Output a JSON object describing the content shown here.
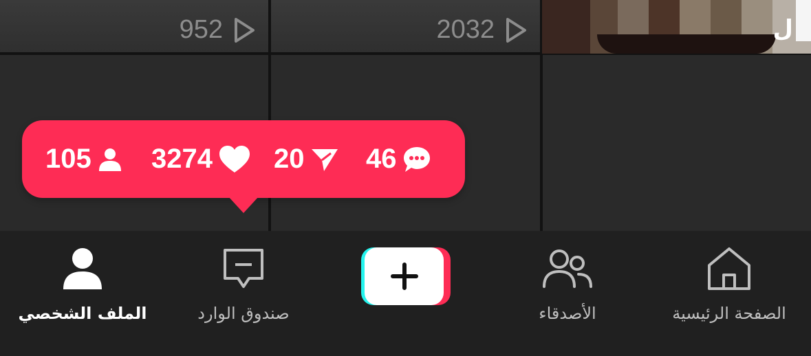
{
  "video_grid": {
    "row1": [
      {
        "views": "952"
      },
      {
        "views": "2032"
      },
      {
        "thumb_char": "ل"
      }
    ]
  },
  "stats_bubble": {
    "followers": "105",
    "likes": "3274",
    "shares": "20",
    "comments": "46"
  },
  "bottom_nav": {
    "profile_label": "الملف الشخصي",
    "inbox_label": "صندوق الوارد",
    "friends_label": "الأصدقاء",
    "home_label": "الصفحة الرئيسية"
  },
  "colors": {
    "accent": "#fe2c55",
    "cyan": "#25f4ee",
    "background": "#1f1f1f"
  }
}
